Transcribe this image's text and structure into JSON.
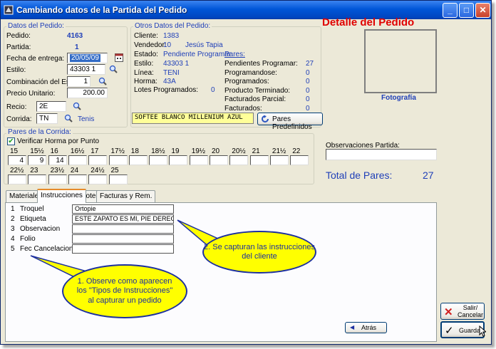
{
  "window": {
    "title": "Cambiando datos de la Partida del Pedido"
  },
  "header": {
    "detail_title": "Detalle del  Pedido",
    "photo_label": "Fotografía"
  },
  "datos_pedido": {
    "group_title": "Datos del Pedido:",
    "pedido_label": "Pedido:",
    "pedido_value": "4163",
    "partida_label": "Partida:",
    "partida_value": "1",
    "fecha_label": "Fecha de entrega:",
    "fecha_value": "20/05/09",
    "estilo_label": "Estilo:",
    "estilo_value": "43303 1",
    "combinacion_label": "Combinación del Estilo:",
    "combinacion_value": "1",
    "precio_label": "Precio Unitario:",
    "precio_value": "200.00",
    "recio_label": "Recio:",
    "recio_value": "2E",
    "corrida_label": "Corrida:",
    "corrida_value": "TN",
    "corrida_desc": "Tenis"
  },
  "otros_datos": {
    "group_title": "Otros Datos del Pedido:",
    "cliente_label": "Cliente:",
    "cliente_value": "1383",
    "vendedor_label": "Vendedor:",
    "vendedor_value": "10",
    "vendedor_name": "Jesús Tapia",
    "estado_label": "Estado:",
    "estado_value": "Pendiente Programar",
    "estilo_label": "Estilo:",
    "estilo_value": "43303 1",
    "linea_label": "Línea:",
    "linea_value": "TENI",
    "horma_label": "Horma:",
    "horma_value": "43A",
    "lotes_label": "Lotes Programados:",
    "lotes_value": "0",
    "description": "SOFTEE BLANCO MILLENIUM AZUL",
    "pares_predef_label": "Pares Predefinidos"
  },
  "pares": {
    "title": "Pares:",
    "rows": [
      {
        "label": "Pendientes Programar:",
        "value": "27"
      },
      {
        "label": "Programandose:",
        "value": "0"
      },
      {
        "label": "Programados:",
        "value": "0"
      },
      {
        "label": "Producto Terminado:",
        "value": "0"
      },
      {
        "label": "Facturados Parcial:",
        "value": "0"
      },
      {
        "label": "Facturados:",
        "value": "0"
      }
    ]
  },
  "corrida": {
    "group_title": "Pares de la Corrida:",
    "verificar_label": "Verificar Horma por Punto",
    "sizes_row1": [
      "15",
      "15½",
      "16",
      "16½",
      "17",
      "17½",
      "18",
      "18½",
      "19",
      "19½",
      "20",
      "20½",
      "21",
      "21½",
      "22"
    ],
    "values_row1": [
      "4",
      "9",
      "14",
      "",
      "",
      "",
      "",
      "",
      "",
      "",
      "",
      "",
      "",
      "",
      ""
    ],
    "sizes_row2": [
      "22½",
      "23",
      "23½",
      "24",
      "24½",
      "25"
    ],
    "values_row2": [
      "",
      "",
      "",
      "",
      "",
      ""
    ]
  },
  "observaciones": {
    "label": "Observaciones Partida:",
    "value": ""
  },
  "total": {
    "label": "Total de Pares:",
    "value": "27"
  },
  "tabs": [
    "Materiales",
    "Instrucciones",
    "Lotes",
    "Facturas y Rem."
  ],
  "instrucciones": [
    {
      "num": "1",
      "label": "Troquel",
      "value": "Ortopie"
    },
    {
      "num": "2",
      "label": "Etiqueta",
      "value": "ESTE ZAPATO ES MI, PIE DERECH"
    },
    {
      "num": "3",
      "label": "Observacion",
      "value": ""
    },
    {
      "num": "4",
      "label": "Folio",
      "value": ""
    },
    {
      "num": "5",
      "label": "Fec Cancelacion",
      "value": ""
    }
  ],
  "callouts": {
    "one": "1. Observe como aparecen los  \"Tipos de Instrucciones\" al capturar un pedido",
    "two": "2. Se capturan las instrucciones del cliente"
  },
  "buttons": {
    "atras": "Atrás",
    "salir": "Salir/ Cancelar",
    "guardar": "Guardar"
  },
  "colors": {
    "title_red": "#e00000",
    "blue_text": "#1f3fb8",
    "callout_fill": "#ffff00"
  }
}
